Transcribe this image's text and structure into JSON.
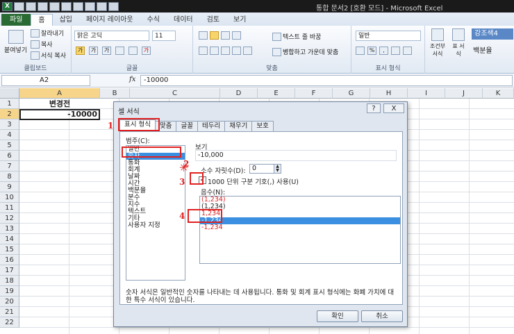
{
  "window": {
    "title": "통합 문서2 [호환 모드] - Microsoft Excel"
  },
  "ribbon_tabs": [
    "파일",
    "홈",
    "삽입",
    "페이지 레이아웃",
    "수식",
    "데이터",
    "검토",
    "보기"
  ],
  "clipboard": {
    "paste": "붙여넣기",
    "cut": "잘라내기",
    "copy": "복사",
    "format_painter": "서식 복사",
    "label": "클립보드"
  },
  "font": {
    "name": "맑은 고딕",
    "size": "11",
    "bold": "가",
    "italic": "가",
    "underline": "가",
    "label": "글꼴"
  },
  "alignment": {
    "wrap": "텍스트 줄 바꿈",
    "merge": "병합하고 가운데 맞춤",
    "label": "맞춤"
  },
  "number": {
    "format": "일반",
    "label": "표시 형식"
  },
  "styles": {
    "conditional": "조건부 서식",
    "table": "표 서식",
    "accent": "강조색4",
    "percent": "백분율"
  },
  "formula_bar": {
    "cell_ref": "A2",
    "fx": "fx",
    "value": "-10000"
  },
  "columns": [
    "A",
    "B",
    "C",
    "D",
    "E",
    "F",
    "G",
    "H",
    "I",
    "J",
    "K"
  ],
  "rows": [
    "1",
    "2",
    "3",
    "4",
    "5",
    "6",
    "7",
    "8",
    "9",
    "10",
    "11",
    "12",
    "13",
    "14",
    "15",
    "16",
    "17",
    "18",
    "19",
    "20",
    "21",
    "22"
  ],
  "cells": {
    "A1": "변경전",
    "A2": "-10000"
  },
  "dialog": {
    "title": "셀 서식",
    "help": "?",
    "close": "X",
    "tabs": [
      "표시 형식",
      "맞춤",
      "글꼴",
      "테두리",
      "채우기",
      "보호"
    ],
    "category_label": "범주(C):",
    "categories": [
      "일반",
      "숫자",
      "통화",
      "회계",
      "날짜",
      "시간",
      "백분율",
      "분수",
      "지수",
      "텍스트",
      "기타",
      "사용자 지정"
    ],
    "sample_label": "보기",
    "sample_value": "-10,000",
    "decimal_label": "소수 자릿수(D):",
    "decimal_value": "0",
    "thousands_label": "1000 단위 구분 기호(,) 사용(U)",
    "negative_label": "음수(N):",
    "negative_options": [
      "(1,234)",
      "(1,234)",
      "1,234",
      "-1,234",
      "-1,234"
    ],
    "description": "숫자 서식은 일반적인 숫자를 나타내는 데 사용됩니다. 통화 및 회계 표시 형식에는 화폐 가치에 대한 특수 서식이 있습니다.",
    "ok": "확인",
    "cancel": "취소"
  },
  "annotations": {
    "n1": "1",
    "n2": "2",
    "n3": "3",
    "n4": "4",
    "star": "✳"
  }
}
